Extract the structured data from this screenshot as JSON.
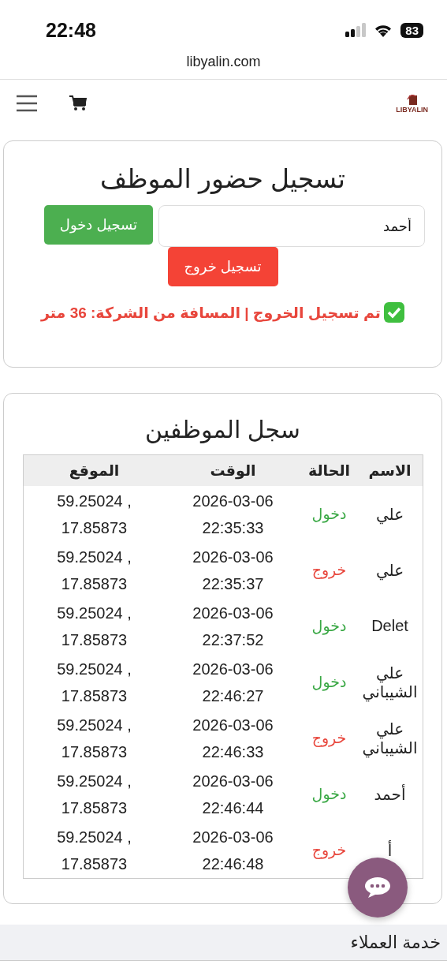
{
  "status_bar": {
    "time": "22:48",
    "battery": "83"
  },
  "browser": {
    "url": "libyalin.com"
  },
  "header": {
    "logo_text": "LIBYALIN"
  },
  "attendance": {
    "title": "تسجيل حضور الموظف",
    "name_field": {
      "value": "أحمد"
    },
    "check_in_button": "تسجيل دخول",
    "check_out_button": "تسجيل خروج",
    "message": "تم تسجيل الخروج | المسافة من الشركة: 36 متر"
  },
  "log": {
    "title": "سجل الموظفين",
    "columns": [
      "الاسم",
      "الحالة",
      "الوقت",
      "الموقع"
    ],
    "rows": [
      {
        "name": "علي",
        "status": "دخول",
        "kind": "in",
        "date": "2026-03-06",
        "time": "22:35:33",
        "lat": "59.25024 ,",
        "lng": "17.85873"
      },
      {
        "name": "علي",
        "status": "خروج",
        "kind": "out",
        "date": "2026-03-06",
        "time": "22:35:37",
        "lat": "59.25024 ,",
        "lng": "17.85873"
      },
      {
        "name": "Delet",
        "status": "دخول",
        "kind": "in",
        "date": "2026-03-06",
        "time": "22:37:52",
        "lat": "59.25024 ,",
        "lng": "17.85873"
      },
      {
        "name": "علي الشيباني",
        "status": "دخول",
        "kind": "in",
        "date": "2026-03-06",
        "time": "22:46:27",
        "lat": "59.25024 ,",
        "lng": "17.85873"
      },
      {
        "name": "علي الشيباني",
        "status": "خروج",
        "kind": "out",
        "date": "2026-03-06",
        "time": "22:46:33",
        "lat": "59.25024 ,",
        "lng": "17.85873"
      },
      {
        "name": "أحمد",
        "status": "دخول",
        "kind": "in",
        "date": "2026-03-06",
        "time": "22:46:44",
        "lat": "59.25024 ,",
        "lng": "17.85873"
      },
      {
        "name": "أ",
        "status": "خروج",
        "kind": "out",
        "date": "2026-03-06",
        "time": "22:46:48",
        "lat": "59.25024 ,",
        "lng": "17.85873"
      }
    ]
  },
  "footer": {
    "title": "خدمة العملاء"
  }
}
